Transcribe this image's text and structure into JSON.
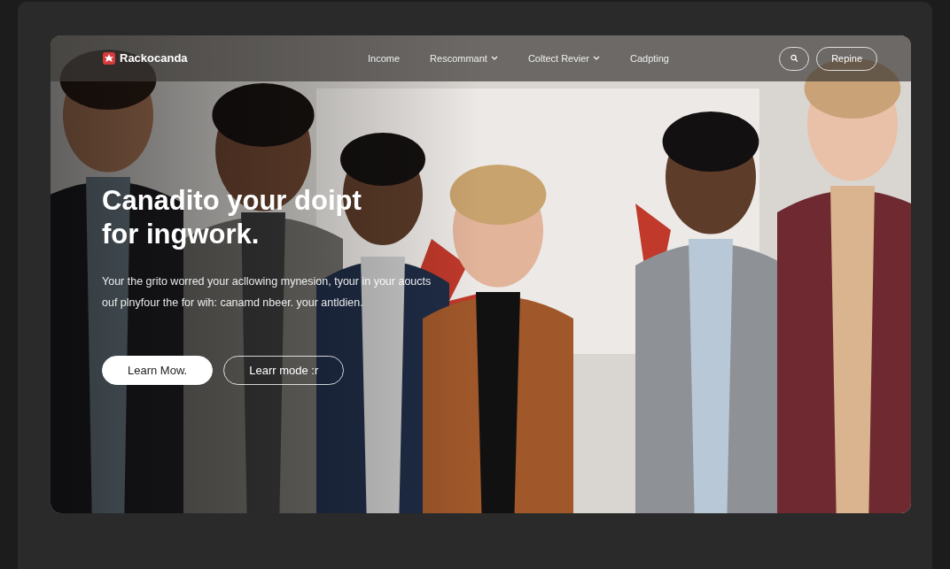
{
  "brand": {
    "name": "Rackocanda"
  },
  "nav": [
    {
      "label": "Income",
      "kind": "link"
    },
    {
      "label": "Rescommant",
      "kind": "menu"
    },
    {
      "label": "Coltect Revier",
      "kind": "menu"
    },
    {
      "label": "Cadpting",
      "kind": "link"
    }
  ],
  "actions": {
    "cta": "Repine"
  },
  "hero": {
    "kind": "picture",
    "headline": "Canadito your doipt for ingwork.",
    "body": "Your the grito worred your acllowing mynesion, tyour in your aoucts ouf plnyfour the for wih: canamd nbeer. your antldien.",
    "buttons": [
      {
        "label": "Learn Mow.",
        "kind": "primary"
      },
      {
        "label": "Learr mode :r",
        "kind": "outline"
      }
    ]
  }
}
